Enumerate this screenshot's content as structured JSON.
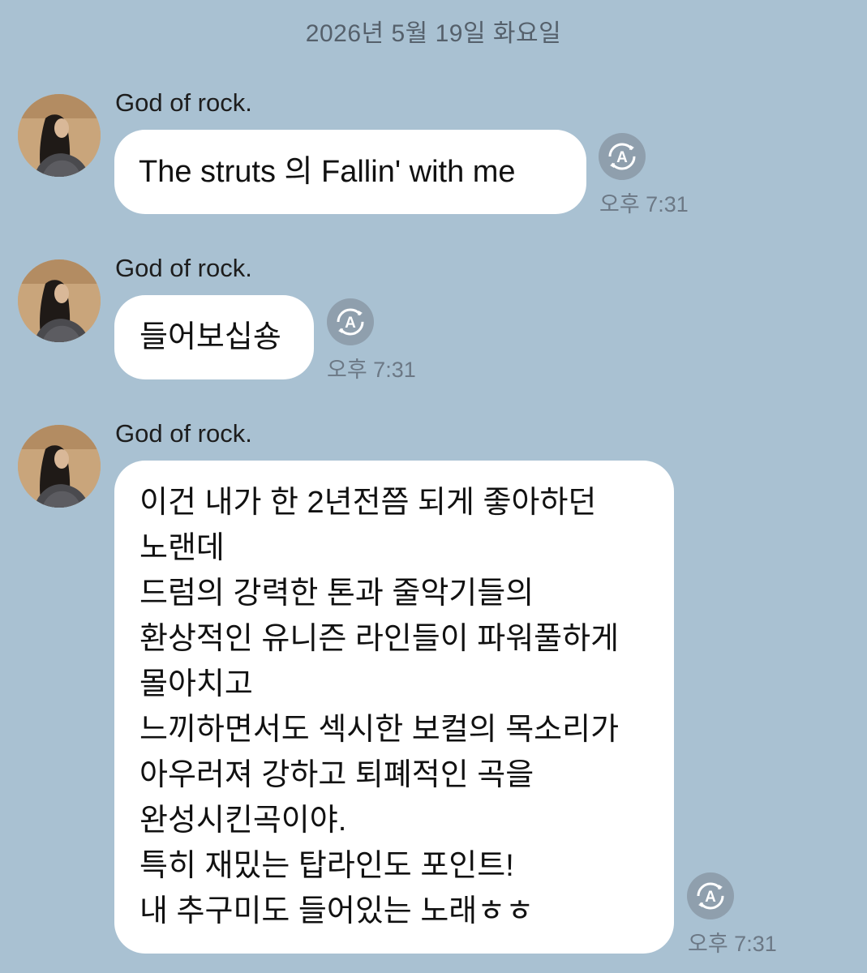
{
  "chat": {
    "date_divider": "2026년 5월 19일 화요일",
    "messages": [
      {
        "sender": "God of rock.",
        "text": "The struts 의 Fallin' with me",
        "time": "오후 7:31"
      },
      {
        "sender": "God of rock.",
        "text": "들어보십숑",
        "time": "오후 7:31"
      },
      {
        "sender": "God of rock.",
        "lines": [
          "이건 내가 한 2년전쯤 되게 좋아하던",
          "노랜데",
          "드럼의 강력한 톤과 줄악기들의",
          "환상적인 유니즌 라인들이 파워풀하게",
          "몰아치고",
          "느끼하면서도 섹시한 보컬의 목소리가",
          "아우러져 강하고 퇴폐적인 곡을",
          "완성시킨곡이야.",
          "특히 재밌는 탑라인도 포인트!",
          "내 추구미도 들어있는 노래ㅎㅎ"
        ],
        "time": "오후 7:31"
      }
    ]
  },
  "icons": {
    "avatar": "profile-photo",
    "translate": "translate-icon"
  },
  "colors": {
    "background": "#a9c1d2",
    "bubble": "#ffffff",
    "translate_button": "#8f9fad"
  }
}
